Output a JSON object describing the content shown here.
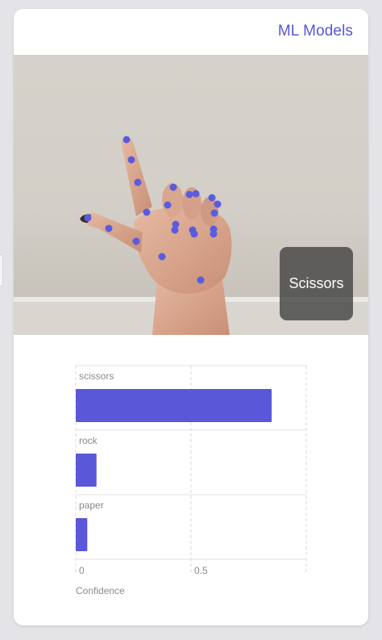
{
  "header": {
    "nav_link_label": "ML Models"
  },
  "camera": {
    "prediction_label": "Scissors",
    "keypoint_color": "#5a5ce0"
  },
  "colors": {
    "accent": "#5856d6",
    "bar": "#5a57d8"
  },
  "chart_data": {
    "type": "bar",
    "orientation": "horizontal",
    "categories": [
      "scissors",
      "rock",
      "paper"
    ],
    "values": [
      0.85,
      0.09,
      0.05
    ],
    "xlabel": "Confidence",
    "ylabel": "",
    "xlim": [
      0,
      1
    ],
    "xticks": [
      "0",
      "0.5"
    ],
    "grid": true
  }
}
